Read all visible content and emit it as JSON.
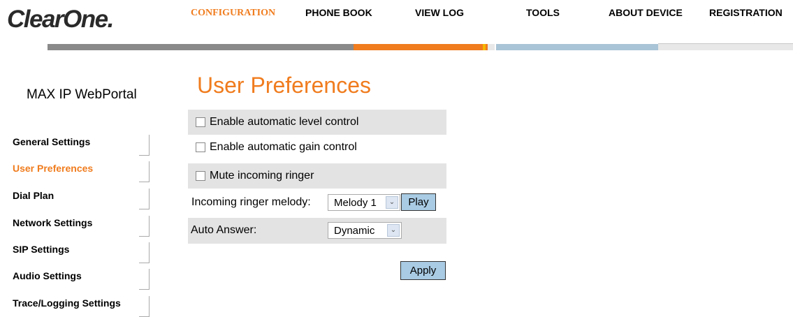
{
  "header": {
    "logo": "ClearOne.",
    "nav": [
      {
        "label": "CONFIGURATION",
        "active": true
      },
      {
        "label": "PHONE BOOK"
      },
      {
        "label": "VIEW LOG"
      },
      {
        "label": "TOOLS"
      },
      {
        "label": "ABOUT DEVICE"
      },
      {
        "label": "REGISTRATION"
      }
    ]
  },
  "colors": {
    "accent": "#f07c1e",
    "gray_bar": "#8a8a8a",
    "orange_bar": "#f07c1e",
    "blue_bar": "#a9c4d6",
    "row_shade": "#e3e3e3",
    "button_bg": "#a9cbe4"
  },
  "sidebar": {
    "portal_title": "MAX IP WebPortal",
    "items": [
      {
        "label": "General Settings"
      },
      {
        "label": "User Preferences",
        "active": true
      },
      {
        "label": "Dial Plan"
      },
      {
        "label": "Network Settings"
      },
      {
        "label": "SIP Settings"
      },
      {
        "label": "Audio Settings"
      },
      {
        "label": "Trace/Logging Settings"
      }
    ]
  },
  "main": {
    "title": "User Preferences",
    "options": [
      {
        "label": "Enable automatic level control",
        "checked": false
      },
      {
        "label": "Enable automatic gain control",
        "checked": false
      },
      {
        "label": "Mute incoming ringer",
        "checked": false
      }
    ],
    "ringer": {
      "label": "Incoming ringer melody:",
      "value": "Melody 1",
      "play_label": "Play"
    },
    "auto_answer": {
      "label": "Auto Answer:",
      "value": "Dynamic"
    },
    "apply_label": "Apply"
  }
}
